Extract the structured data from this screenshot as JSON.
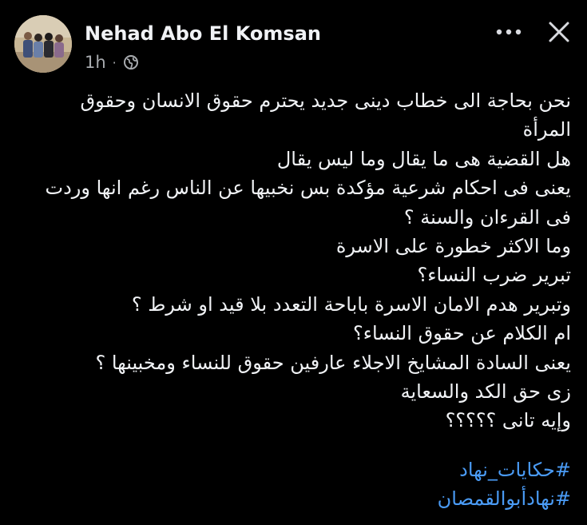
{
  "post": {
    "author": "Nehad Abo El Komsan",
    "time": "1h",
    "separator": "·",
    "audience_icon": "globe-icon",
    "more_icon": "more-options-icon",
    "close_icon": "close-icon",
    "body_lines": [
      "نحن بحاجة الى خطاب دينى جديد يحترم حقوق الانسان وحقوق",
      "المرأة",
      "هل القضية هى ما يقال وما ليس يقال",
      "يعنى فى احكام شرعية مؤكدة بس نخبيها عن الناس رغم انها وردت",
      "فى القرءان والسنة ؟",
      "وما الاكثر خطورة على الاسرة",
      "تبرير ضرب النساء؟",
      "وتبرير هدم الامان الاسرة باباحة التعدد بلا قيد او شرط ؟",
      "ام الكلام عن حقوق النساء؟",
      "يعنى السادة المشايخ الاجلاء عارفين حقوق للنساء ومخبينها ؟",
      "زى حق الكد والسعاية",
      "وإيه تانى ؟؟؟؟؟"
    ],
    "hashtags": [
      "#حكايات_نهاد",
      "#نهادأبوالقمصان"
    ]
  },
  "colors": {
    "background": "#000000",
    "text": "#f0f2f5",
    "secondary_text": "#a8abaf",
    "link": "#4a9bf5"
  }
}
